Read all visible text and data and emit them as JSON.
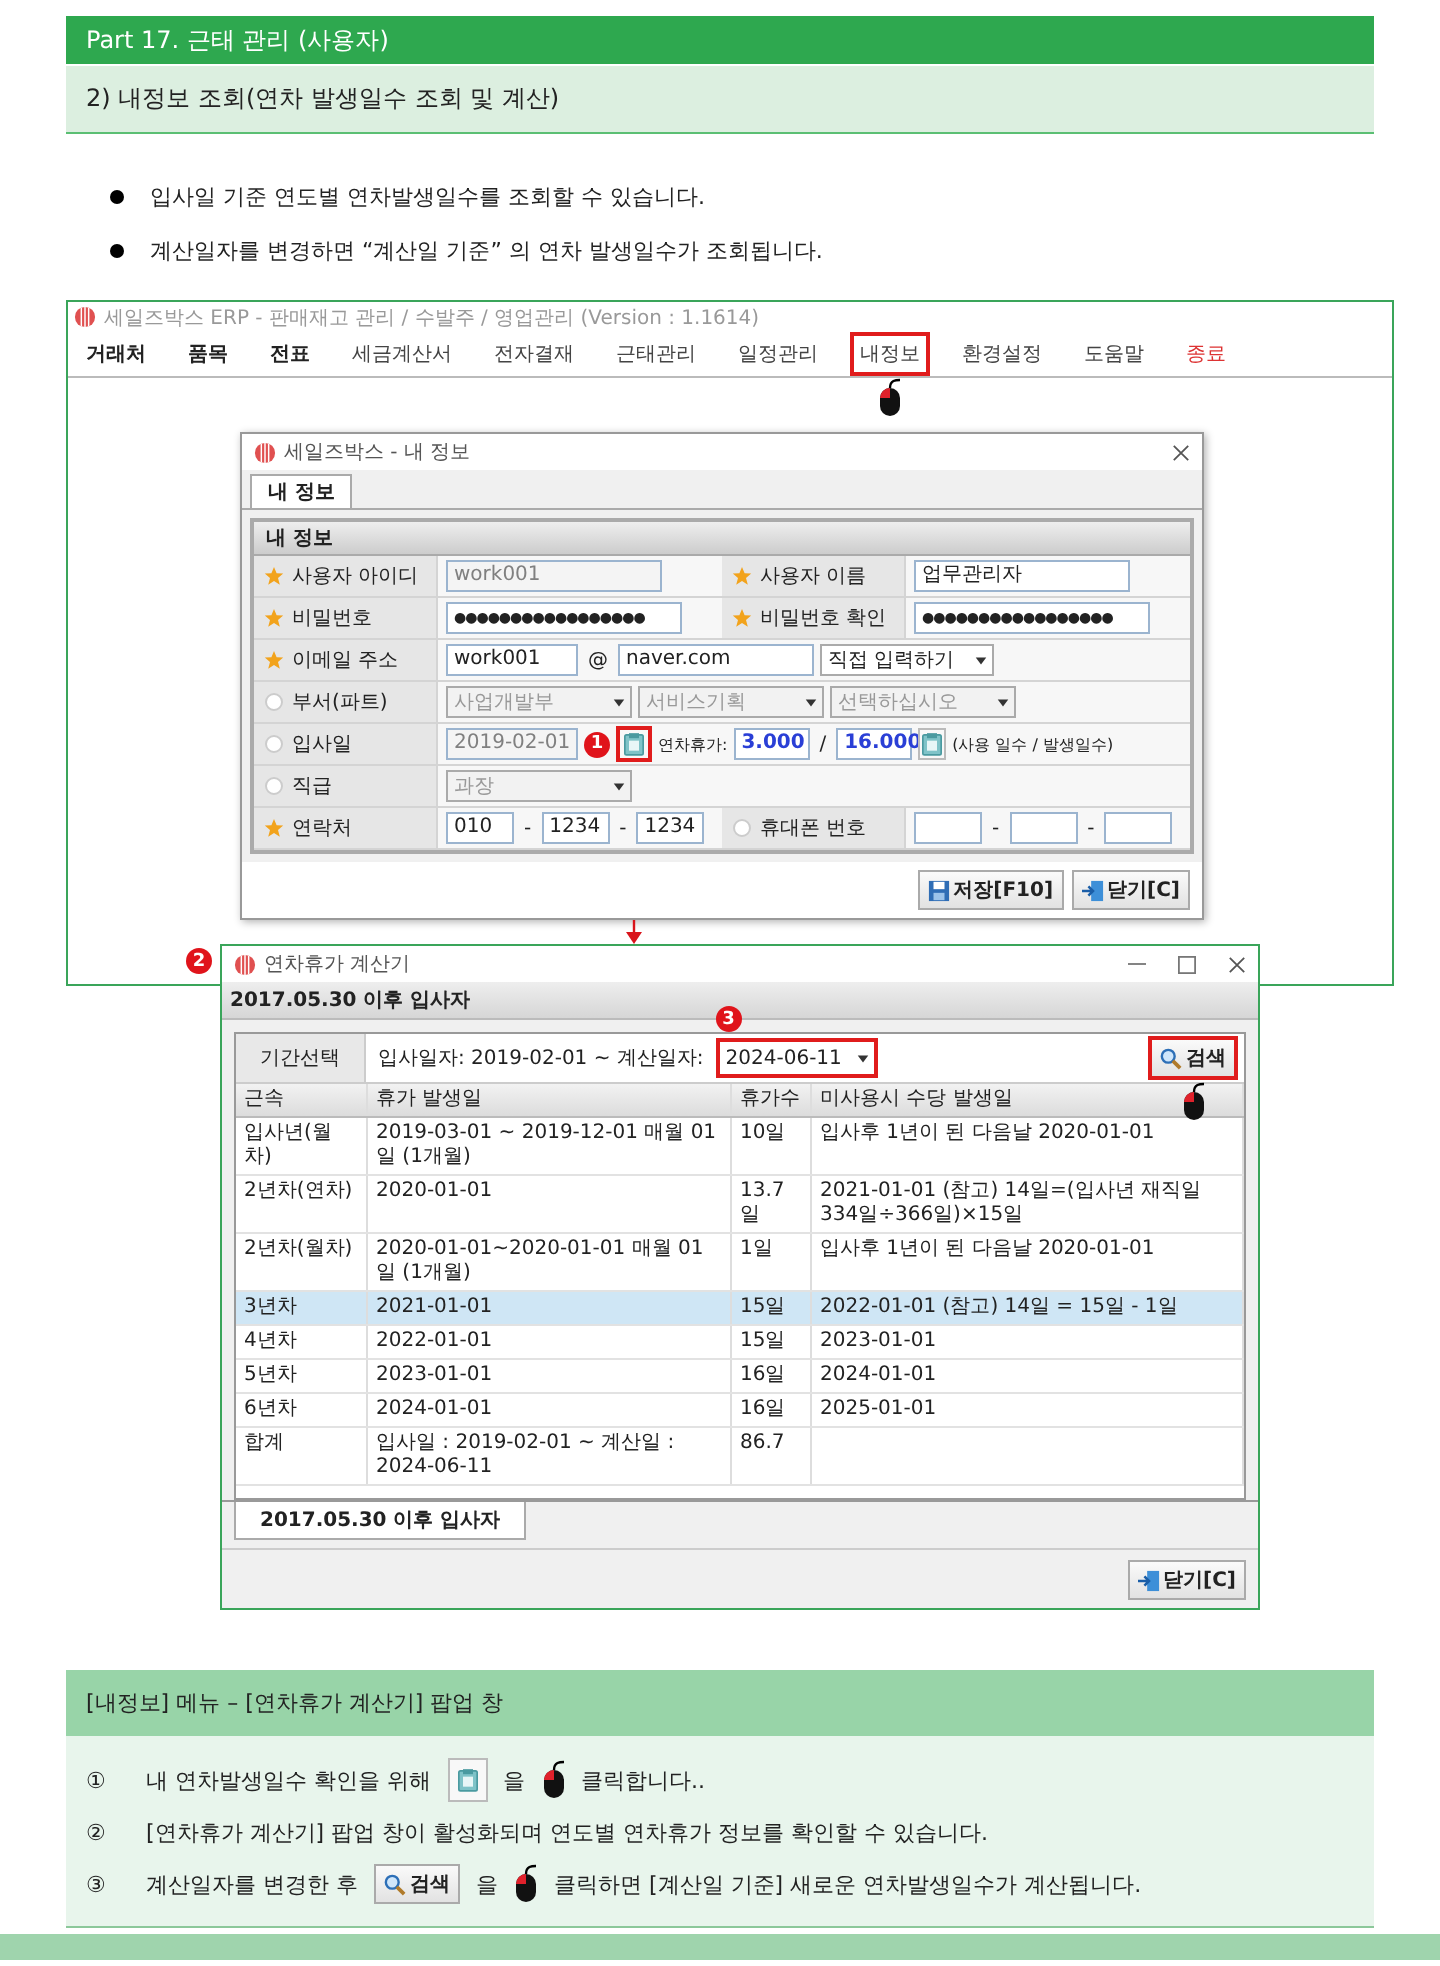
{
  "header": {
    "part_title": "Part 17. 근태 관리 (사용자)",
    "section_title": "2) 내정보 조회(연차 발생일수 조회 및 계산)"
  },
  "bullets": [
    "입사일 기준 연도별 연차발생일수를 조회할 수 있습니다.",
    "계산일자를 변경하면 “계산일 기준” 의 연차 발생일수가 조회됩니다."
  ],
  "erp_window": {
    "title": "세일즈박스 ERP - 판매재고 관리 / 수발주 / 영업관리 (Version : 1.1614)",
    "menu": [
      {
        "label": "거래처",
        "kind": "bold",
        "highlighted": false
      },
      {
        "label": "품목",
        "kind": "bold",
        "highlighted": false
      },
      {
        "label": "전표",
        "kind": "bold",
        "highlighted": false
      },
      {
        "label": "세금계산서",
        "kind": "normal",
        "highlighted": false
      },
      {
        "label": "전자결재",
        "kind": "normal",
        "highlighted": false
      },
      {
        "label": "근태관리",
        "kind": "normal",
        "highlighted": false
      },
      {
        "label": "일정관리",
        "kind": "normal",
        "highlighted": false
      },
      {
        "label": "내정보",
        "kind": "normal",
        "highlighted": true
      },
      {
        "label": "환경설정",
        "kind": "normal",
        "highlighted": false
      },
      {
        "label": "도움말",
        "kind": "normal",
        "highlighted": false
      },
      {
        "label": "종료",
        "kind": "exit",
        "highlighted": false
      }
    ]
  },
  "my_info_dialog": {
    "title": "세일즈박스 - 내 정보",
    "tab": "내 정보",
    "group_title": "내 정보",
    "callout": "1",
    "rows": [
      {
        "kind": "pair",
        "fields": [
          {
            "label": "사용자 아이디",
            "required": true,
            "value": "work001",
            "disabled": true,
            "kind": "text"
          },
          {
            "label": "사용자 이름",
            "required": true,
            "value": "업무관리자",
            "disabled": false,
            "kind": "text"
          }
        ]
      },
      {
        "kind": "pair",
        "fields": [
          {
            "label": "비밀번호",
            "required": true,
            "value": "●●●●●●●●●●●●●●●●●",
            "disabled": false,
            "kind": "password"
          },
          {
            "label": "비밀번호 확인",
            "required": true,
            "value": "●●●●●●●●●●●●●●●●●",
            "disabled": false,
            "kind": "password"
          }
        ]
      },
      {
        "kind": "email",
        "label": "이메일 주소",
        "required": true,
        "user": "work001",
        "at": "@",
        "domain": "naver.com",
        "domain_select": "직접 입력하기"
      },
      {
        "kind": "selects",
        "label": "부서(파트)",
        "required": false,
        "options": [
          "사업개발부",
          "서비스기획",
          "선택하십시오"
        ]
      },
      {
        "kind": "join_date",
        "label": "입사일",
        "required": false,
        "date": "2019-02-01",
        "icon_highlighted": true,
        "leave_label": "연차휴가:",
        "used": "3.000",
        "slash": "/",
        "granted": "16.000",
        "note": "(사용 일수 / 발생일수)"
      },
      {
        "kind": "selects",
        "label": "직급",
        "required": false,
        "options": [
          "과장"
        ]
      },
      {
        "kind": "phone",
        "separator": "-",
        "fields": [
          {
            "label": "연락처",
            "required": true,
            "parts": [
              {
                "kind": "value",
                "value": "010"
              },
              {
                "kind": "value",
                "value": "1234"
              },
              {
                "kind": "value",
                "value": "1234"
              }
            ]
          },
          {
            "label": "휴대폰 번호",
            "required": false,
            "parts": [
              {
                "kind": "empty"
              },
              {
                "kind": "empty"
              },
              {
                "kind": "empty"
              }
            ]
          }
        ]
      }
    ],
    "buttons": [
      {
        "label": "저장[F10]",
        "kind": "save"
      },
      {
        "label": "닫기[C]",
        "kind": "close"
      }
    ]
  },
  "calculator": {
    "title": "연차휴가 계산기",
    "callout": "2",
    "subtitle": "2017.05.30 이후 입사자",
    "period_label": "기간선택",
    "period_text": "입사일자: 2019-02-01 ~ 계산일자:",
    "date": {
      "value": "2024-06-11",
      "highlighted": true,
      "callout": "3"
    },
    "search": {
      "label": "검색",
      "highlighted": true
    },
    "columns": [
      "근속",
      "휴가 발생일",
      "휴가수",
      "미사용시 수당 발생일"
    ],
    "rows": [
      {
        "cells": [
          "입사년(월차)",
          "2019-03-01 ~ 2019-12-01 매월 01일 (1개월)",
          "10일",
          "입사후 1년이 된 다음날 2020-01-01"
        ],
        "selected": false
      },
      {
        "cells": [
          "2년차(연차)",
          "2020-01-01",
          "13.7일",
          "2021-01-01 (참고) 14일=(입사년 재직일334일÷366일)×15일"
        ],
        "selected": false
      },
      {
        "cells": [
          "2년차(월차)",
          "2020-01-01~2020-01-01 매월 01일 (1개월)",
          "1일",
          "입사후 1년이 된 다음날 2020-01-01"
        ],
        "selected": false
      },
      {
        "cells": [
          "3년차",
          "2021-01-01",
          "15일",
          "2022-01-01 (참고) 14일 = 15일 - 1일"
        ],
        "selected": true
      },
      {
        "cells": [
          "4년차",
          "2022-01-01",
          "15일",
          "2023-01-01"
        ],
        "selected": false
      },
      {
        "cells": [
          "5년차",
          "2023-01-01",
          "16일",
          "2024-01-01"
        ],
        "selected": false
      },
      {
        "cells": [
          "6년차",
          "2024-01-01",
          "16일",
          "2025-01-01"
        ],
        "selected": false
      },
      {
        "cells": [
          "합계",
          "입사일 : 2019-02-01 ~ 계산일 : 2024-06-11",
          "86.7"
        ],
        "selected": false
      }
    ],
    "tab": "2017.05.30 이후 입사자",
    "close_button": "닫기[C]"
  },
  "instructions": {
    "title": "[내정보] 메뉴 – [연차휴가 계산기] 팝업 창",
    "steps": [
      {
        "number": "①",
        "segments": [
          {
            "kind": "text",
            "text": "내 연차발생일수 확인을 위해"
          },
          {
            "kind": "calendar_button"
          },
          {
            "kind": "text",
            "text": "을"
          },
          {
            "kind": "mouse"
          },
          {
            "kind": "text",
            "text": "클릭합니다.."
          }
        ]
      },
      {
        "number": "②",
        "segments": [
          {
            "kind": "text",
            "text": "[연차휴가 계산기]  팝업 창이 활성화되며 연도별 연차휴가 정보를 확인할 수 있습니다."
          }
        ]
      },
      {
        "number": "③",
        "segments": [
          {
            "kind": "text",
            "text": "계산일자를 변경한 후"
          },
          {
            "kind": "search_button",
            "text": "검색"
          },
          {
            "kind": "text",
            "text": "을"
          },
          {
            "kind": "mouse"
          },
          {
            "kind": "text",
            "text": "클릭하면 [계산일 기준] 새로운 연차발생일수가 계산됩니다."
          }
        ]
      }
    ]
  }
}
